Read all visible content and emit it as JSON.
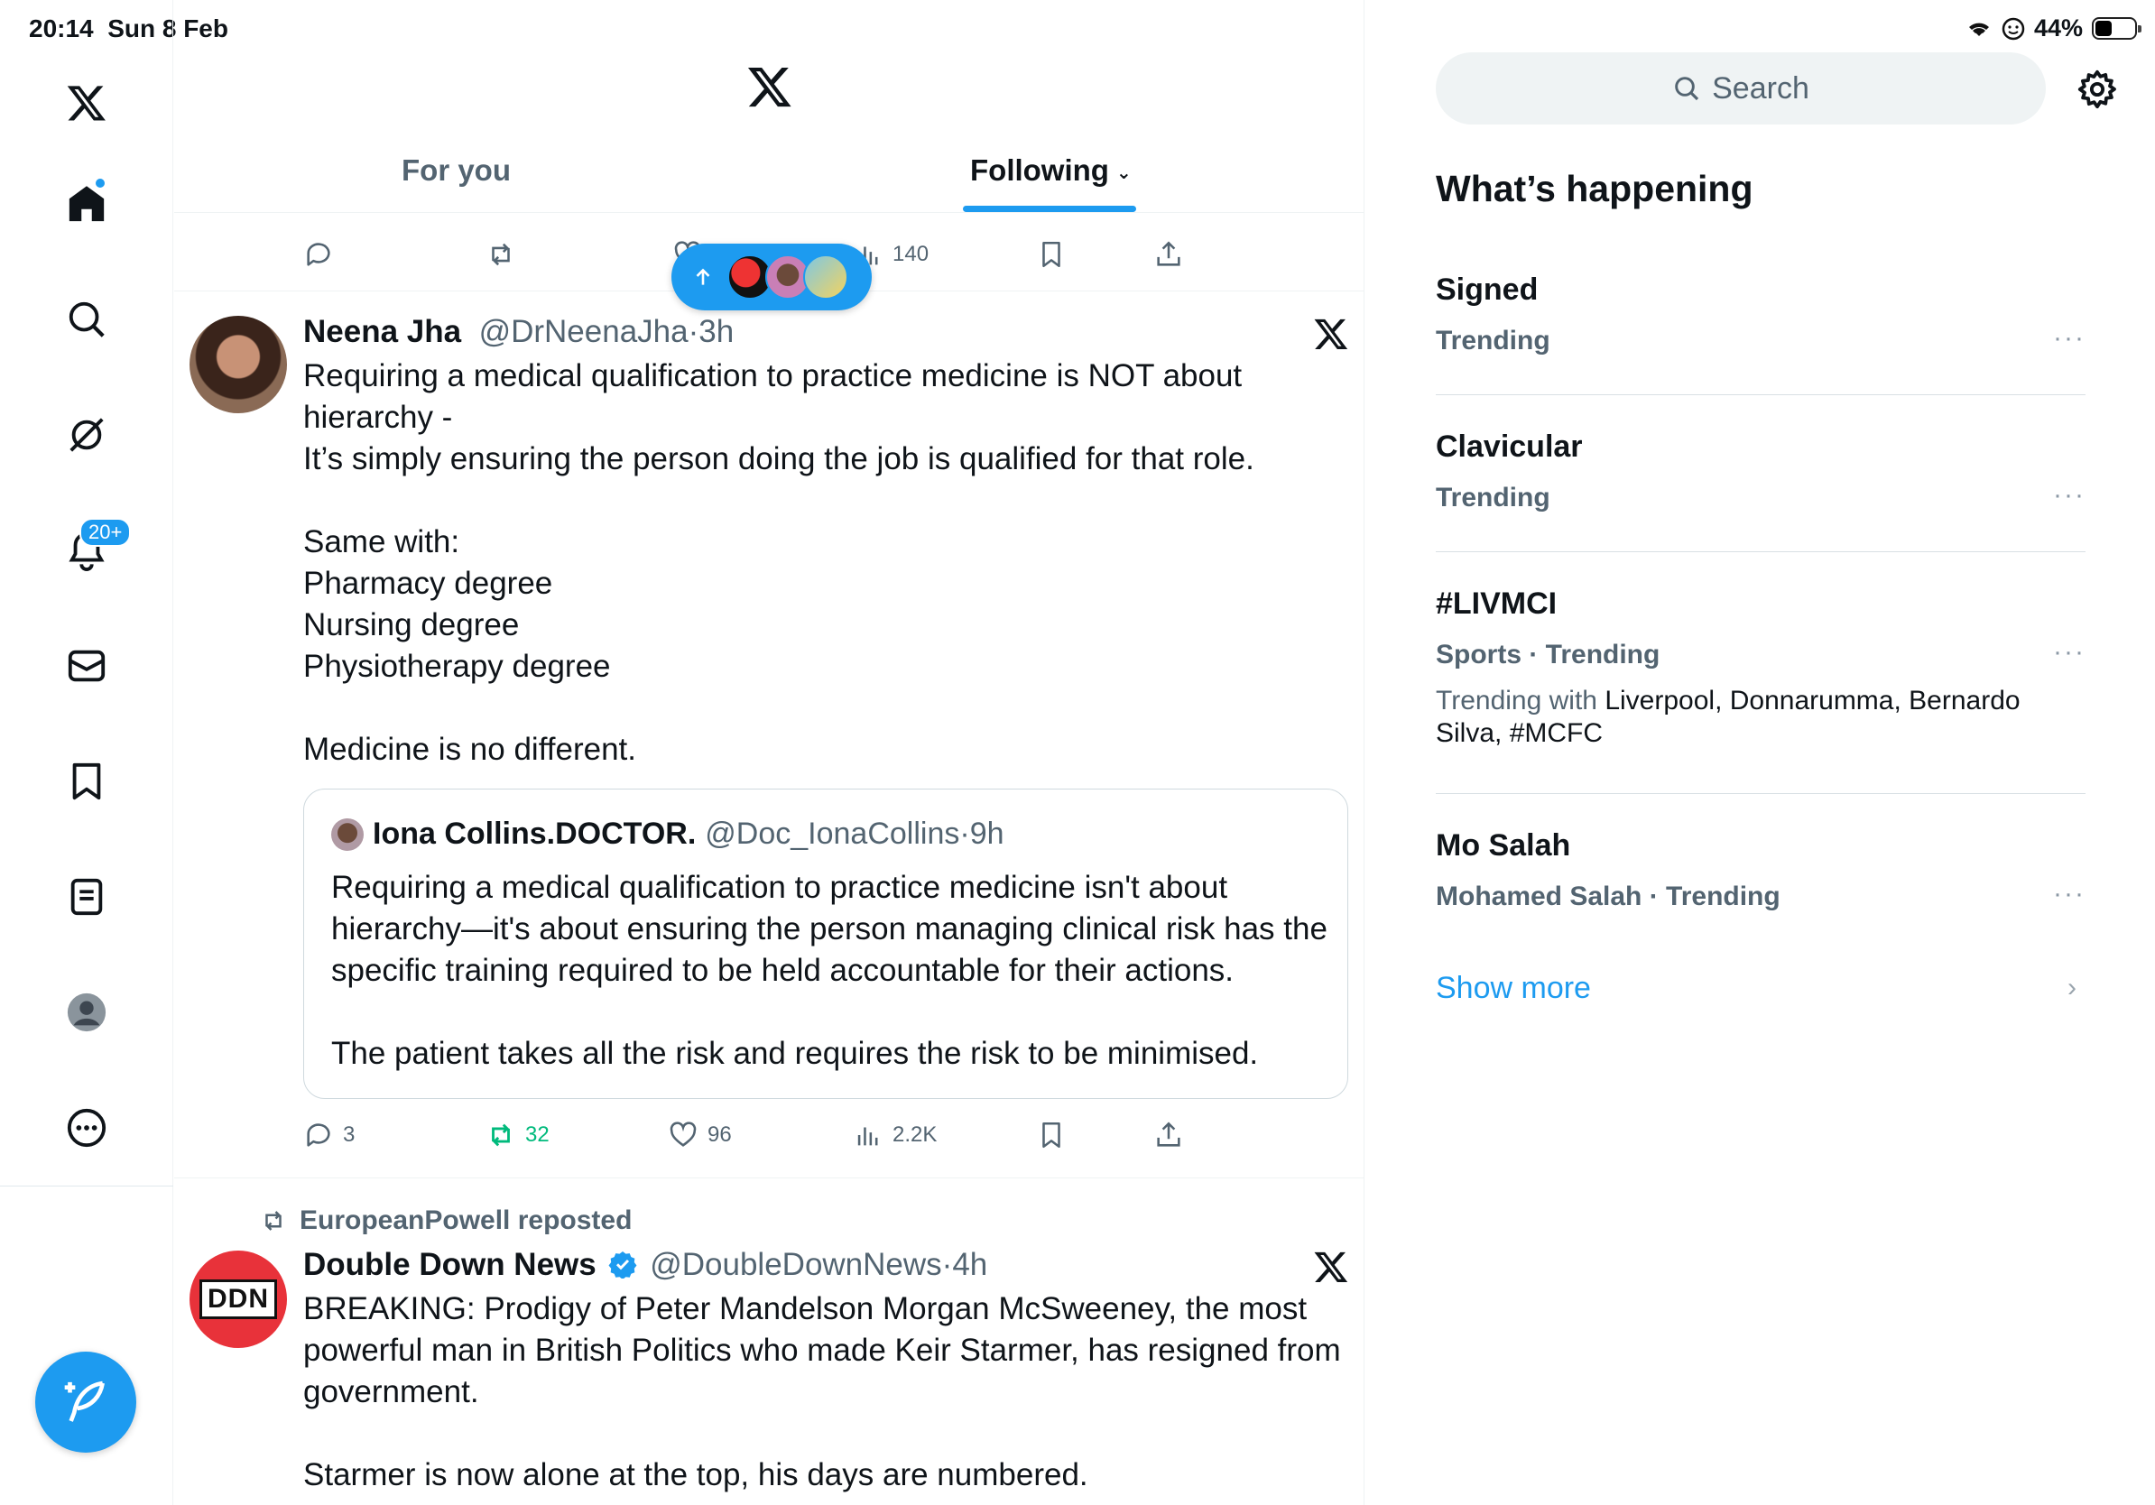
{
  "status": {
    "time": "20:14",
    "date": "Sun 8 Feb",
    "battery": "44%"
  },
  "nav": {
    "notifications_badge": "20+",
    "icons": [
      "x-logo-icon",
      "home-icon",
      "search-icon",
      "grok-icon",
      "notifications-icon",
      "messages-icon",
      "bookmarks-icon",
      "lists-icon",
      "profile-icon",
      "more-icon"
    ]
  },
  "tabs": {
    "for_you": "For you",
    "following": "Following"
  },
  "prev_tweet": {
    "views": "140"
  },
  "tweet1": {
    "name": "Neena Jha",
    "handle": "@DrNeenaJha",
    "time": "3h",
    "body": "Requiring a medical qualification to practice medicine is NOT about\nhierarchy -\nIt’s simply ensuring the person doing the job is qualified for that role.\n\nSame with:\nPharmacy degree\nNursing degree\nPhysiotherapy degree\n\nMedicine is no different.",
    "quote": {
      "name": "Iona Collins.DOCTOR.",
      "handle": "@Doc_IonaCollins",
      "time": "9h",
      "body": "Requiring a medical qualification to practice medicine isn't about\nhierarchy—it's about ensuring the person managing clinical risk has the\nspecific training required to be held accountable for their actions.\n\nThe patient takes all the risk and requires the risk to be minimised."
    },
    "replies": "3",
    "reposts": "32",
    "likes": "96",
    "views": "2.2K"
  },
  "tweet2": {
    "repost_by": "EuropeanPowell reposted",
    "name": "Double Down News",
    "handle": "@DoubleDownNews",
    "time": "4h",
    "avatar_text": "DDN",
    "body": "BREAKING: Prodigy of Peter Mandelson Morgan McSweeney, the most\npowerful man in British Politics who made Keir Starmer, has resigned from\ngovernment.\n\nStarmer is now alone at the top, his days are numbered."
  },
  "sidebar": {
    "search_placeholder": "Search",
    "title": "What’s happening",
    "trends": [
      {
        "name": "Signed",
        "meta": "Trending"
      },
      {
        "name": "Clavicular",
        "meta": "Trending"
      },
      {
        "name": "#LIVMCI",
        "meta": "Sports · Trending",
        "with_label": "Trending with",
        "with_names": "Liverpool, Donnarumma, Bernardo Silva, #MCFC"
      },
      {
        "name": "Mo Salah",
        "meta": "Mohamed Salah · Trending"
      }
    ],
    "more_dots": "···",
    "show_more": "Show more"
  },
  "colors": {
    "accent": "#1d9bf0",
    "repost_green": "#00ba7c",
    "secondary_text": "#536471",
    "ddn_red": "#e8323a"
  }
}
